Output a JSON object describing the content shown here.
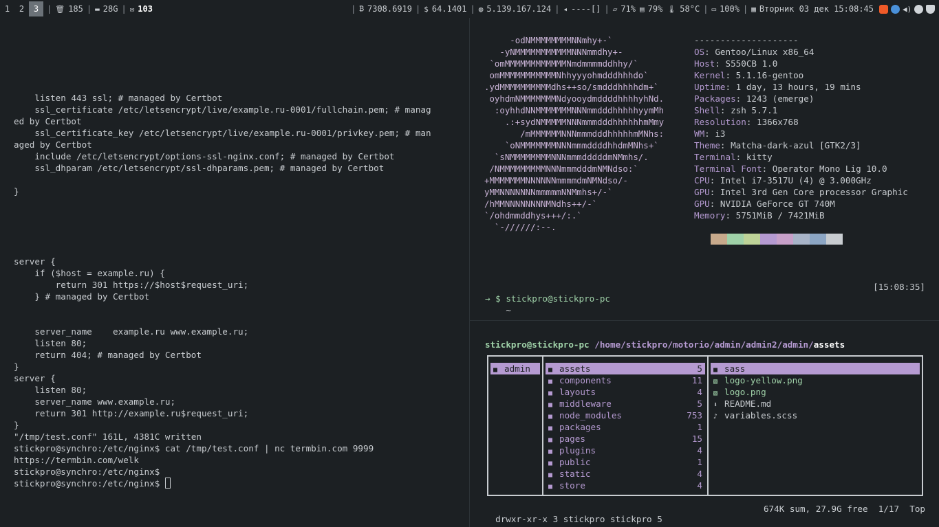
{
  "topbar": {
    "workspaces": [
      "1",
      "2",
      "3"
    ],
    "active_workspace": "3",
    "trash": "185",
    "folder": "28G",
    "mail": "103",
    "bitcoin": "7308.6919",
    "dollar": "64.1401",
    "ip": "5.139.167.124",
    "volume": "----[]",
    "disk": "71%",
    "memory": "79%",
    "temp": "58°C",
    "battery": "100%",
    "datetime": "Вторник 03 дек 15:08:45",
    "colors": {
      "brave": "#f05a28",
      "globe": "#4a90d9",
      "tray": "#d0d4d8"
    }
  },
  "left_terminal": {
    "lines": [
      "    listen 443 ssl; # managed by Certbot",
      "    ssl_certificate /etc/letsencrypt/live/example.ru-0001/fullchain.pem; # manag",
      "ed by Certbot",
      "    ssl_certificate_key /etc/letsencrypt/live/example.ru-0001/privkey.pem; # man",
      "aged by Certbot",
      "    include /etc/letsencrypt/options-ssl-nginx.conf; # managed by Certbot",
      "    ssl_dhparam /etc/letsencrypt/ssl-dhparams.pem; # managed by Certbot",
      "",
      "}",
      "",
      "",
      "",
      "",
      "",
      "server {",
      "    if ($host = example.ru) {",
      "        return 301 https://$host$request_uri;",
      "    } # managed by Certbot",
      "",
      "",
      "    server_name    example.ru www.example.ru;",
      "    listen 80;",
      "    return 404; # managed by Certbot",
      "}",
      "server {",
      "    listen 80;",
      "    server_name www.example.ru;",
      "    return 301 http://example.ru$request_uri;",
      "}",
      "\"/tmp/test.conf\" 161L, 4381C written",
      "stickpro@synchro:/etc/nginx$ cat /tmp/test.conf | nc termbin.com 9999",
      "https://termbin.com/welk",
      "stickpro@synchro:/etc/nginx$ ",
      "stickpro@synchro:/etc/nginx$ "
    ]
  },
  "neofetch": {
    "logo": [
      "     -odNMMMMMMMMNNmhy+-`",
      "   -yNMMMMMMMMMMMNNNmmdhy+-",
      " `omMMMMMMMMMMMMNmdmmmmddhhy/`",
      " omMMMMMMMMMMMNhhyyyohmdddhhhdo`",
      ".ydMMMMMMMMMMdhs++so/smdddhhhhdm+`",
      " oyhdmNMMMMMMMNdyooydmddddhhhhyhNd.",
      "  :oyhhdNNMMMMMMMNNNmmdddhhhhhyymMh",
      "    .:+sydNMMMMMNNNmmmdddhhhhhhmMmy",
      "       /mMMMMMMNNNmmmdddhhhhhmMNhs:",
      "    `oNMMMMMMMNNNmmmddddhhdmMNhs+`",
      "  `sNMMMMMMMMNNNmmmdddddmNMmhs/.",
      " /NMMMMMMMMMNNNmmmdddmNMNdso:`",
      "+MMMMMMMNNNNNNmmmmdmNMNdso/-",
      "yMMNNNNNNNmmmmmNNMmhs+/-`",
      "/hMMNNNNNNNNMNdhs++/-`",
      "`/ohdmmddhys+++/:.`",
      "  `-//////:--."
    ],
    "separator": "--------------------",
    "info": [
      {
        "key": "OS",
        "value": "Gentoo/Linux x86_64"
      },
      {
        "key": "Host",
        "value": "S550CB 1.0"
      },
      {
        "key": "Kernel",
        "value": "5.1.16-gentoo"
      },
      {
        "key": "Uptime",
        "value": "1 day, 13 hours, 19 mins"
      },
      {
        "key": "Packages",
        "value": "1243 (emerge)"
      },
      {
        "key": "Shell",
        "value": "zsh 5.7.1"
      },
      {
        "key": "Resolution",
        "value": "1366x768"
      },
      {
        "key": "WM",
        "value": "i3"
      },
      {
        "key": "Theme",
        "value": "Matcha-dark-azul [GTK2/3]"
      },
      {
        "key": "Terminal",
        "value": "kitty"
      },
      {
        "key": "Terminal Font",
        "value": "Operator Mono Lig 10.0"
      },
      {
        "key": "CPU",
        "value": "Intel i7-3517U (4) @ 3.000GHz"
      },
      {
        "key": "GPU",
        "value": "Intel 3rd Gen Core processor Graphic"
      },
      {
        "key": "GPU",
        "value": "NVIDIA GeForce GT 740M"
      },
      {
        "key": "Memory",
        "value": "5751MiB / 7421MiB"
      }
    ],
    "swatches": [
      "#c7a98b",
      "#9fd1a8",
      "#bed398",
      "#b59ad1",
      "#c7a0c9",
      "#a8b4c8",
      "#8ca6c4",
      "#c8ccd0"
    ]
  },
  "top_prompt": {
    "user": "stickpro@stickpro-pc",
    "dir": "~",
    "time": "[15:08:35]",
    "arrow": "→ $"
  },
  "ranger": {
    "user": "stickpro@stickpro-pc",
    "path": "/home/stickpro/motorio/admin/admin2/admin/",
    "current": "assets",
    "parent": [
      {
        "name": "admin",
        "sel": true
      }
    ],
    "dirs": [
      {
        "name": "assets",
        "count": "5",
        "sel": true
      },
      {
        "name": "components",
        "count": "11"
      },
      {
        "name": "layouts",
        "count": "4"
      },
      {
        "name": "middleware",
        "count": "5"
      },
      {
        "name": "node_modules",
        "count": "753"
      },
      {
        "name": "packages",
        "count": "1"
      },
      {
        "name": "pages",
        "count": "15"
      },
      {
        "name": "plugins",
        "count": "4"
      },
      {
        "name": "public",
        "count": "1"
      },
      {
        "name": "static",
        "count": "4"
      },
      {
        "name": "store",
        "count": "4"
      }
    ],
    "preview": [
      {
        "name": "sass",
        "type": "dir",
        "sel": true
      },
      {
        "name": "logo-yellow.png",
        "type": "png"
      },
      {
        "name": "logo.png",
        "type": "png"
      },
      {
        "name": "README.md",
        "type": "md"
      },
      {
        "name": "variables.scss",
        "type": "scss"
      }
    ],
    "status_left": "drwxr-xr-x 3 stickpro stickpro 5",
    "status_right": "674K sum, 27.9G free  1/17  Top"
  }
}
